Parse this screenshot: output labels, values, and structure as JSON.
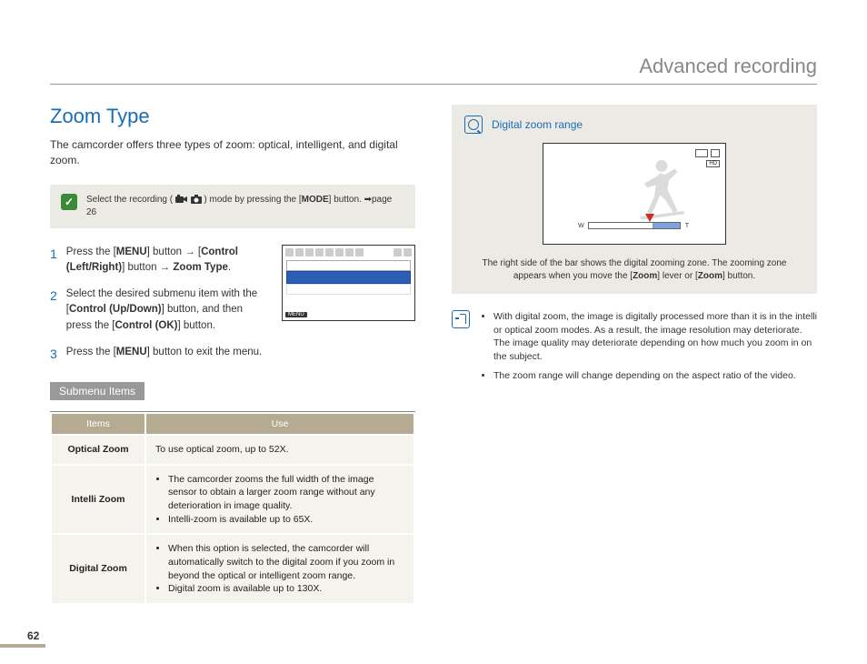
{
  "header": {
    "title": "Advanced recording"
  },
  "section": {
    "title": "Zoom Type",
    "intro": "The camcorder offers three types of zoom: optical, intelligent, and digital zoom."
  },
  "mode_note": {
    "prefix": "Select the recording ( ",
    "suffix": " ) mode by pressing the [",
    "bold": "MODE",
    "end": "] button. ➡page 26"
  },
  "steps": [
    "Press the [MENU] button → [Control (Left/Right)] button → Zoom Type.",
    "Select the desired submenu item with the [Control (Up/Down)] button, and then press the [Control (OK)] button.",
    "Press the [MENU] button to exit the menu."
  ],
  "steps_rich": {
    "s1": {
      "a": "Press the [",
      "b": "MENU",
      "c": "] button → [",
      "d": "Control (Left/Right)",
      "e": "] button → ",
      "f": "Zoom Type",
      "g": "."
    },
    "s2": {
      "a": "Select the desired submenu item with the [",
      "b": "Control (Up/Down)",
      "c": "] button, and then press the [",
      "d": "Control (OK)",
      "e": "] button."
    },
    "s3": {
      "a": "Press the [",
      "b": "MENU",
      "c": "] button to exit the menu."
    }
  },
  "screen_mock": {
    "menu_label": "MENU"
  },
  "submenu": {
    "heading": "Submenu Items",
    "headers": {
      "items": "Items",
      "use": "Use"
    },
    "rows": [
      {
        "item": "Optical Zoom",
        "use_text": "To use optical zoom, up to 52X."
      },
      {
        "item": "Intelli Zoom",
        "use_bullets": [
          "The camcorder zooms the full width of the image sensor to obtain a larger zoom range without any deterioration in image quality.",
          "Intelli-zoom is available up to 65X."
        ]
      },
      {
        "item": "Digital Zoom",
        "use_bullets": [
          "When this option is selected, the camcorder will automatically switch to the digital zoom if you zoom in beyond the optical or intelligent zoom range.",
          "Digital zoom is available up to 130X."
        ]
      }
    ]
  },
  "range": {
    "title": "Digital zoom range",
    "caption_a": "The right side of the bar shows the digital zooming zone. The zooming zone appears when you move the [",
    "caption_b": "Zoom",
    "caption_c": "] lever or [",
    "caption_d": "Zoom",
    "caption_e": "] button."
  },
  "info": {
    "bullets": [
      "With digital zoom, the image is digitally processed more than it is in the intelli or optical zoom modes. As a result, the image resolution may deteriorate. The image quality may deteriorate depending on how much you zoom in on the subject.",
      "The zoom range will change depending on the aspect ratio of the video."
    ]
  },
  "page_number": "62"
}
